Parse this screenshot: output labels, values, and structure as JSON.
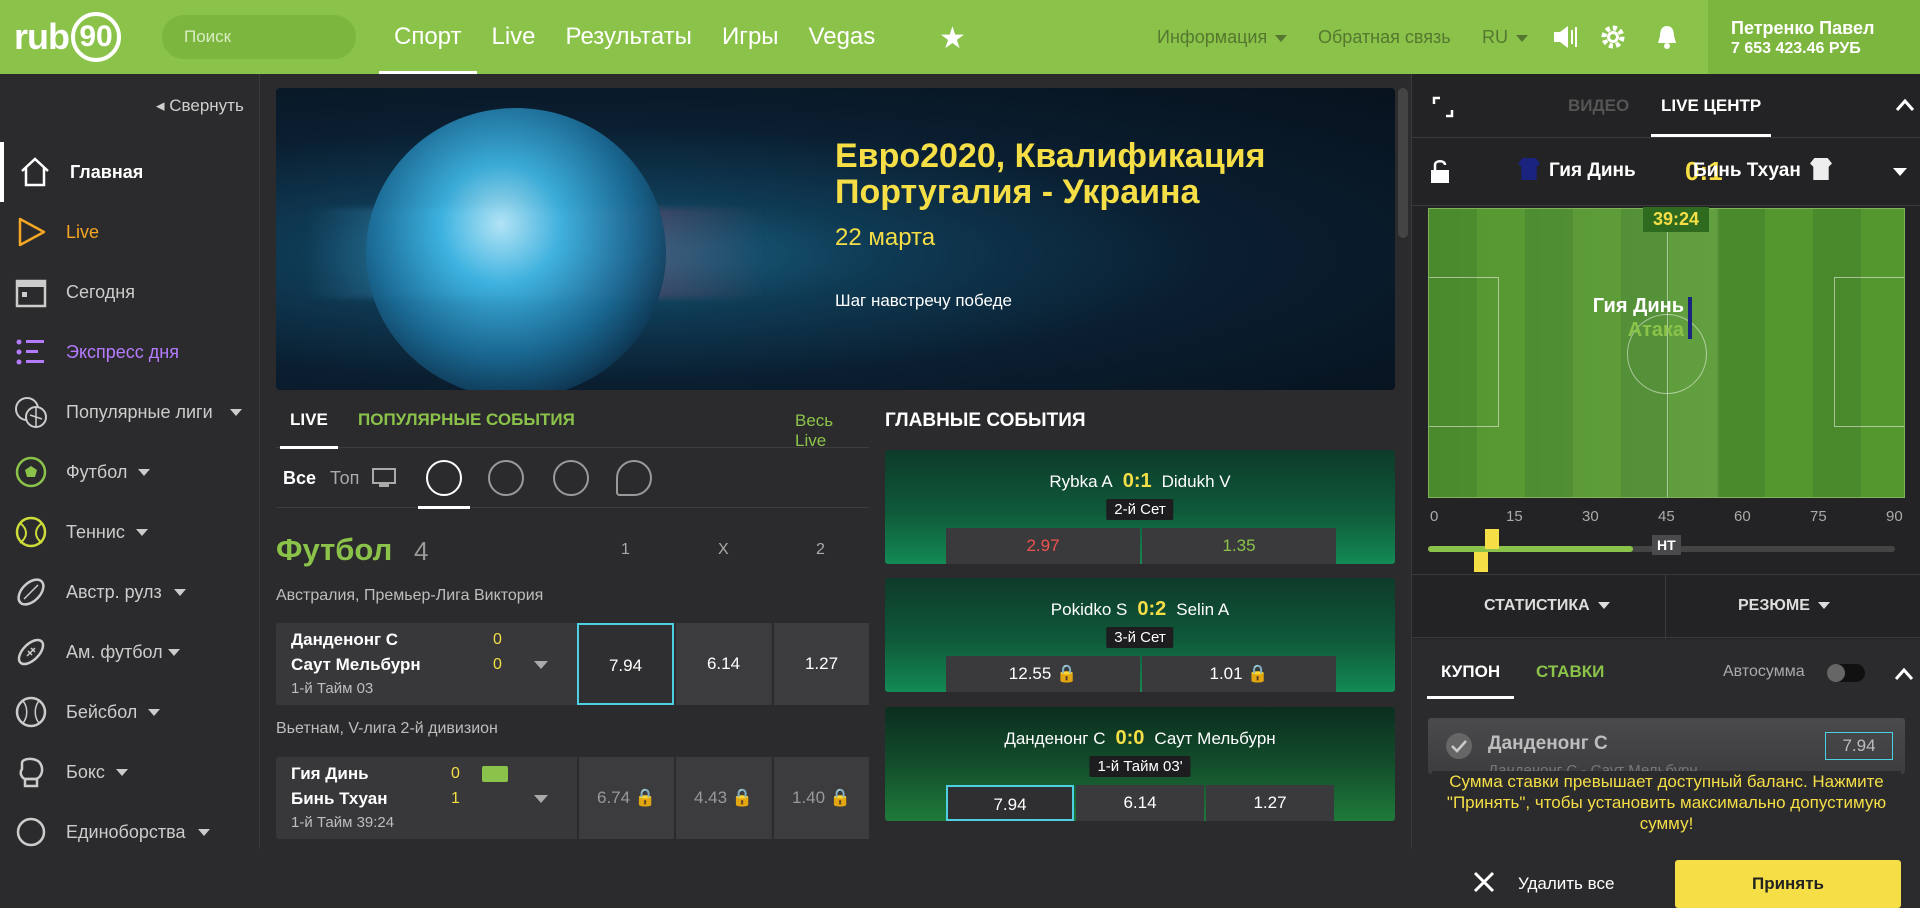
{
  "header": {
    "logo_text": "rub",
    "logo_num": "90",
    "search_placeholder": "Поиск",
    "nav": [
      "Спорт",
      "Live",
      "Результаты",
      "Игры",
      "Vegas"
    ],
    "info": "Информация",
    "feedback": "Обратная связь",
    "lang": "RU",
    "user_name": "Петренко Павел",
    "balance": "7 653 423.46 РУБ"
  },
  "sidebar": {
    "collapse": "Свернуть",
    "items": [
      {
        "label": "Главная",
        "icon": "home-icon"
      },
      {
        "label": "Live",
        "icon": "play-icon"
      },
      {
        "label": "Сегодня",
        "icon": "calendar-icon"
      },
      {
        "label": "Экспресс дня",
        "icon": "list-icon"
      },
      {
        "label": "Популярные лиги",
        "icon": "balls-icon"
      },
      {
        "label": "Футбол",
        "icon": "soccer-icon"
      },
      {
        "label": "Теннис",
        "icon": "tennis-icon"
      },
      {
        "label": "Австр. рулз",
        "icon": "aussie-ball-icon"
      },
      {
        "label": "Ам. футбол",
        "icon": "football-icon"
      },
      {
        "label": "Бейсбол",
        "icon": "baseball-icon"
      },
      {
        "label": "Бокс",
        "icon": "boxing-icon"
      },
      {
        "label": "Единоборства",
        "icon": "fight-icon"
      }
    ]
  },
  "banner": {
    "title1": "Евро2020, Квалификация",
    "title2": "Португалия - Украина",
    "date": "22 марта",
    "subtitle": "Шаг навстречу победе"
  },
  "live": {
    "tab_live": "LIVE",
    "tab_popular": "ПОПУЛЯРНЫЕ СОБЫТИЯ",
    "all_live": "Весь Live",
    "filter_all": "Все",
    "filter_top": "Топ",
    "sport_title": "Футбол",
    "sport_count": "4",
    "col1": "1",
    "colx": "X",
    "col2": "2",
    "league1": "Австралия, Премьер-Лига Виктория",
    "match1": {
      "t1": "Данденонг С",
      "t2": "Саут Мельбурн",
      "s1": "0",
      "s2": "0",
      "time": "1-й Тайм 03",
      "o1": "7.94",
      "ox": "6.14",
      "o2": "1.27"
    },
    "league2": "Вьетнам, V-лига 2-й дивизион",
    "match2": {
      "t1": "Гия Динь",
      "t2": "Бинь Тхуан",
      "s1": "0",
      "s2": "1",
      "time": "1-й Тайм 39:24",
      "o1": "6.74",
      "ox": "4.43",
      "o2": "1.40"
    }
  },
  "main_events": {
    "title": "ГЛАВНЫЕ СОБЫТИЯ",
    "cards": [
      {
        "p1": "Rybka A",
        "score": "0:1",
        "p2": "Didukh V",
        "period": "2-й Сет",
        "o1": "2.97",
        "o2": "1.35"
      },
      {
        "p1": "Pokidko S",
        "score": "0:2",
        "p2": "Selin A",
        "period": "3-й Сет",
        "o1": "12.55",
        "o2": "1.01"
      },
      {
        "p1": "Данденонг С",
        "score": "0:0",
        "p2": "Саут Мельбурн",
        "period": "1-й Тайм 03'",
        "o1": "7.94",
        "ox": "6.14",
        "o2": "1.27"
      }
    ]
  },
  "right": {
    "video": "ВИДЕО",
    "live_center": "LIVE ЦЕНТР",
    "team1": "Гия Динь",
    "score": "0:1",
    "team2": "Бинь Тхуан",
    "timer": "39:24",
    "attack_team": "Гия Динь",
    "attack_label": "Атака",
    "timeline": [
      "0",
      "15",
      "30",
      "45",
      "60",
      "75",
      "90"
    ],
    "ht": "HT",
    "progress": 0.44,
    "stats": "СТАТИСТИКА",
    "summary": "РЕЗЮМЕ"
  },
  "coupon": {
    "tab_coupon": "КУПОН",
    "tab_bets": "СТАВКИ",
    "auto": "Автосумма",
    "bet_name": "Данденонг С",
    "bet_odd": "7.94",
    "bet_sub": "Данденонг С - Саут Мельбурн",
    "warning": "Сумма ставки превышает доступный баланс. Нажмите \"Принять\", чтобы установить максимально допустимую сумму!",
    "delete_all": "Удалить все",
    "accept": "Принять"
  }
}
